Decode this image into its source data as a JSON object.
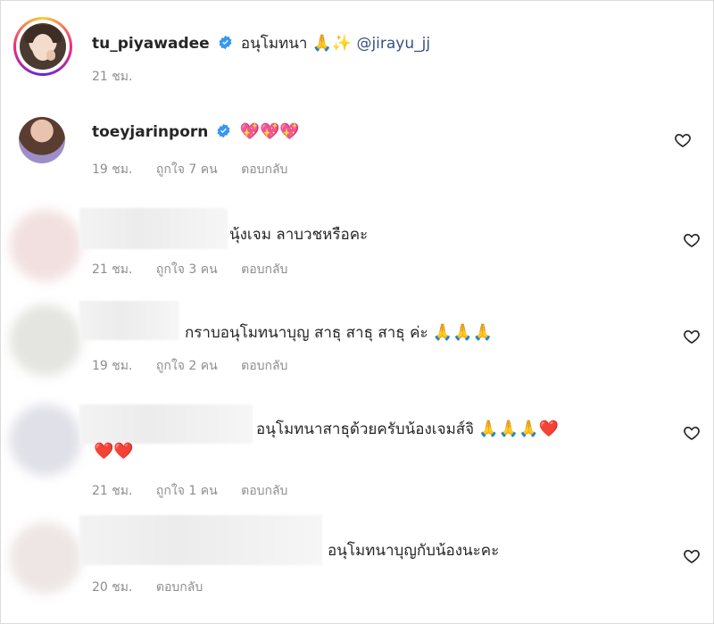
{
  "post": {
    "username": "tu_piyawadee",
    "caption": "อนุโมทนา",
    "caption_emojis": "🙏✨",
    "mention": "@jirayu_jj",
    "time": "21 ชม."
  },
  "comments": [
    {
      "username": "toeyjarinporn",
      "verified": true,
      "text": "",
      "emojis": "💖💖💖",
      "time": "19 ชม.",
      "likes": "ถูกใจ 7 คน",
      "reply": "ตอบกลับ"
    },
    {
      "username": "",
      "text": "นุ้งเจม ลาบวชหรือคะ",
      "emojis": "",
      "time": "21 ชม.",
      "likes": "ถูกใจ 3 คน",
      "reply": "ตอบกลับ"
    },
    {
      "username": "",
      "text": "กราบอนุโมทนาบุญ สาธุ สาธุ สาธุ ค่ะ",
      "emojis": "🙏🙏🙏",
      "time": "19 ชม.",
      "likes": "ถูกใจ 2 คน",
      "reply": "ตอบกลับ"
    },
    {
      "username": "",
      "text": "อนุโมทนาสาธุด้วยครับน้องเจมส์จิ",
      "emojis": "🙏🙏🙏❤️",
      "emojis_line2": "❤️❤️",
      "time": "21 ชม.",
      "likes": "ถูกใจ 1 คน",
      "reply": "ตอบกลับ"
    },
    {
      "username": "",
      "text": "อนุโมทนาบุญกับน้องนะคะ",
      "emojis": "",
      "time": "20 ชม.",
      "likes": "",
      "reply": "ตอบกลับ"
    }
  ],
  "colors": {
    "text": "#262626",
    "meta": "#8e8e8e",
    "mention": "#385185",
    "verified": "#3897f0"
  }
}
